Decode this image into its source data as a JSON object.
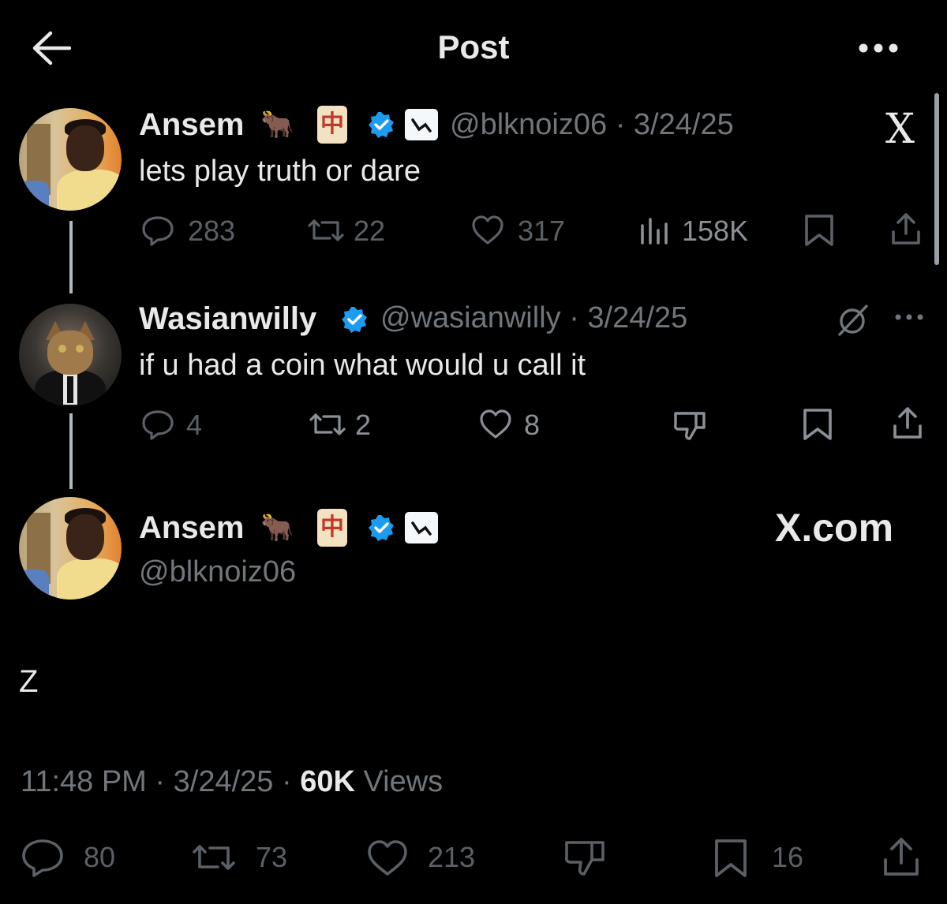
{
  "header": {
    "title": "Post",
    "back_icon": "arrow-left-icon",
    "more_icon": "more-horizontal-icon"
  },
  "posts": [
    {
      "name": "Ansem",
      "handle": "@blknoiz06",
      "date": "3/24/25",
      "text": "lets play truth or dare",
      "emoji_tile": "中",
      "emoji_bull": "🐂",
      "stats": {
        "replies": "283",
        "reposts": "22",
        "likes": "317",
        "views": "158K"
      }
    },
    {
      "name": "Wasianwilly",
      "handle": "@wasianwilly",
      "date": "3/24/25",
      "text": "if u had a coin what would u call it",
      "more": "···",
      "stats": {
        "replies": "4",
        "reposts": "2",
        "likes": "8"
      }
    }
  ],
  "main_post": {
    "name": "Ansem",
    "handle": "@blknoiz06",
    "emoji_tile": "中",
    "emoji_bull": "🐂",
    "text": "Z",
    "time": "11:48 PM",
    "date": "3/24/25",
    "views_count": "60K",
    "views_label": "Views",
    "stats": {
      "replies": "80",
      "reposts": "73",
      "likes": "213",
      "bookmarks": "16"
    }
  },
  "watermark": {
    "x_logo": "X",
    "site": "X.com"
  },
  "colors": {
    "background": "#000000",
    "verified": "#1d9bf0",
    "muted": "#71767b",
    "text": "#e7e9ea"
  }
}
